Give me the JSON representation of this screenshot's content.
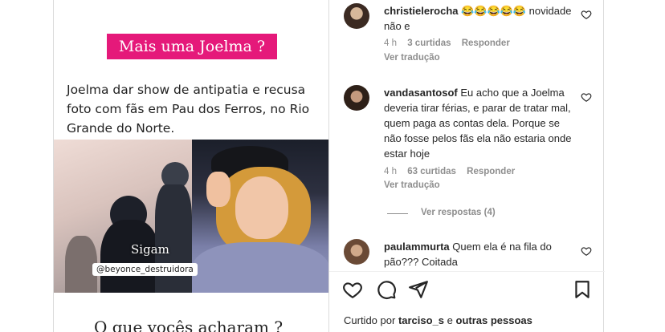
{
  "post": {
    "title": "Mais uma Joelma ?",
    "body": "Joelma dar show de antipatia e recusa foto com fãs em Pau dos Ferros, no Rio Grande do Norte.",
    "photo_caption": "Sigam",
    "photo_handle": "@beyonce_destruidora",
    "question": "O que vocês acharam ?",
    "colors": {
      "title_bg": "#e5197a"
    }
  },
  "comments": [
    {
      "username": "christielerocha",
      "text": "😂😂😂😂😂 novidade não e",
      "time": "4 h",
      "likes": "3 curtidas",
      "reply": "Responder",
      "translate": "Ver tradução"
    },
    {
      "username": "vandasantosof",
      "text": "Eu acho que a Joelma deveria tirar férias, e parar de tratar mal, quem paga as contas dela. Porque se não fosse pelos fãs ela não estaria onde estar hoje",
      "time": "4 h",
      "likes": "63 curtidas",
      "reply": "Responder",
      "translate": "Ver tradução",
      "view_replies": "Ver respostas (4)"
    },
    {
      "username": "paulammurta",
      "text": "Quem ela é na fila do pão??? Coitada"
    }
  ],
  "actions": {
    "icons": [
      "heart-icon",
      "comment-icon",
      "share-icon",
      "bookmark-icon"
    ]
  },
  "liked_by": {
    "prefix": "Curtido por",
    "user": "tarciso_s",
    "conjunction": "e",
    "others": "outras pessoas"
  }
}
